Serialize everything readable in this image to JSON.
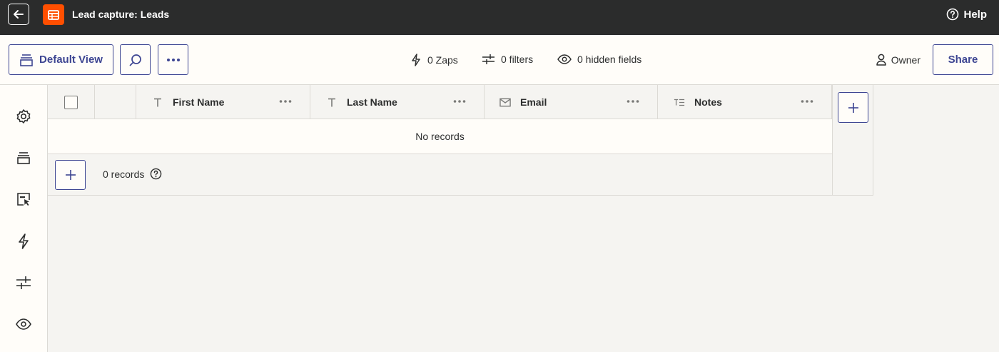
{
  "header": {
    "title": "Lead capture: Leads",
    "help_label": "Help"
  },
  "toolbar": {
    "view_label": "Default View",
    "zaps": "0 Zaps",
    "filters": "0 filters",
    "hidden_fields": "0 hidden fields",
    "owner": "Owner",
    "share_label": "Share"
  },
  "table": {
    "columns": [
      {
        "label": "First Name",
        "icon": "text-type-icon"
      },
      {
        "label": "Last Name",
        "icon": "text-type-icon"
      },
      {
        "label": "Email",
        "icon": "email-type-icon"
      },
      {
        "label": "Notes",
        "icon": "long-text-type-icon"
      }
    ],
    "empty_message": "No records",
    "record_count": "0 records"
  },
  "colors": {
    "topbar": "#2b2c2c",
    "accent": "#3d4592",
    "brand": "#ff4f00",
    "background": "#f5f4f1"
  }
}
